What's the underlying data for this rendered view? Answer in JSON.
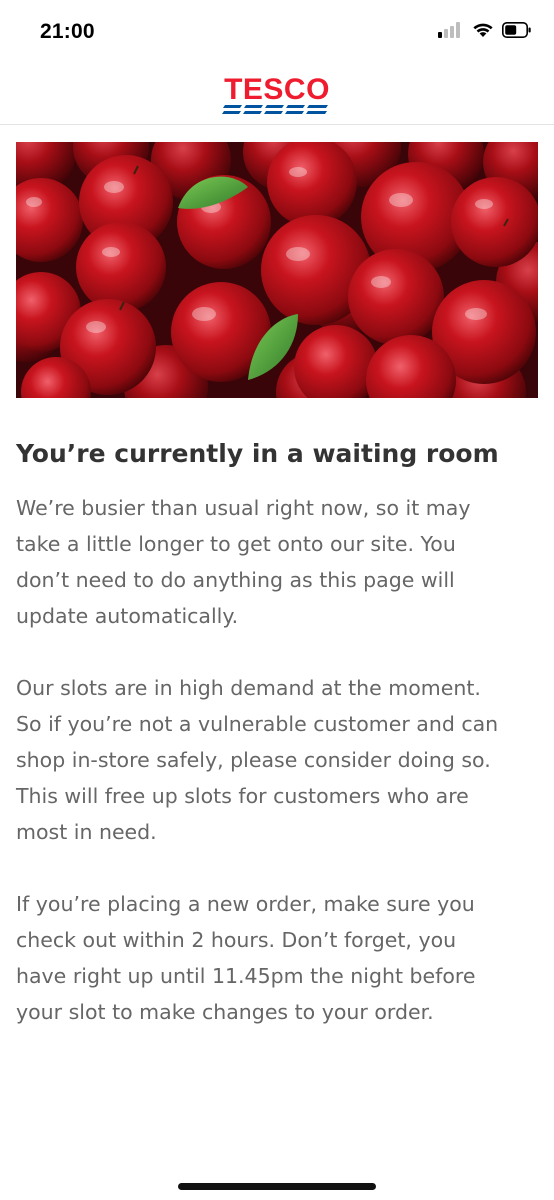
{
  "status_bar": {
    "time": "21:00",
    "icons": [
      "cellular-signal-icon",
      "wifi-icon",
      "battery-icon"
    ]
  },
  "header": {
    "logo_text": "TESCO",
    "brand_colors": {
      "red": "#ee1c2e",
      "blue": "#00539f"
    }
  },
  "hero": {
    "image": "red-apples-photo"
  },
  "content": {
    "title": "You’re currently in a waiting room",
    "paragraphs": [
      [
        "We’re busier than usual right now, so it may",
        "take a little longer to get onto our site. You",
        "don’t need to do anything as this page will",
        "update automatically."
      ],
      [
        "Our slots are in high demand at the moment.",
        "So if you’re not a vulnerable customer and can",
        "shop in-store safely, please consider doing so.",
        "This will free up slots for customers who are",
        "most in need."
      ],
      [
        "If you’re placing a new order, make sure you",
        "check out within 2 hours. Don’t forget, you",
        "have right up until 11.45pm the night before",
        "your slot to make changes to your order."
      ]
    ]
  }
}
